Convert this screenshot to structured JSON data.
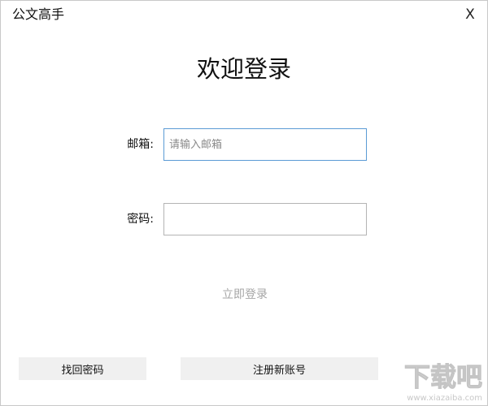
{
  "window": {
    "title": "公文高手",
    "close_label": "X"
  },
  "login": {
    "heading": "欢迎登录",
    "email_label": "邮箱:",
    "email_placeholder": "请输入邮箱",
    "email_value": "",
    "password_label": "密码:",
    "password_value": "",
    "submit_label": "立即登录"
  },
  "footer": {
    "recover_label": "找回密码",
    "register_label": "注册新账号"
  },
  "watermark": {
    "text": "下载吧",
    "url": "www.xiazaiba.com"
  },
  "colors": {
    "focus_border": "#5b9bd5",
    "disabled_text": "#a6a6a6",
    "button_bg": "#f0f0f0"
  }
}
